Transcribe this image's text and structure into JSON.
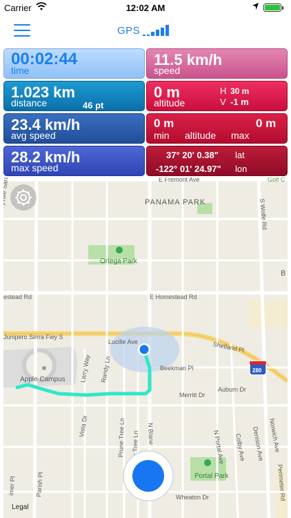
{
  "status_bar": {
    "carrier": "Carrier",
    "time": "12:02 AM"
  },
  "nav": {
    "title": "GPS",
    "menu_icon": "hamburger-icon",
    "signal_icon": "signal-bars-icon"
  },
  "stats": {
    "time": {
      "value": "00:02:44",
      "label": "time"
    },
    "speed": {
      "value": "11.5 km/h",
      "label": "speed"
    },
    "distance": {
      "value": "1.023 km",
      "label": "distance",
      "points": "46 pt"
    },
    "altitude": {
      "value": "0 m",
      "label": "altitude",
      "h_label": "H",
      "h_value": "30 m",
      "v_label": "V",
      "v_value": "-1 m"
    },
    "avg_speed": {
      "value": "23.4 km/h",
      "label": "avg speed"
    },
    "altitude_minmax": {
      "min_value": "0 m",
      "max_value": "0 m",
      "min_label": "min",
      "mid_label": "altitude",
      "max_label": "max"
    },
    "max_speed": {
      "value": "28.2 km/h",
      "label": "max speed"
    },
    "coords": {
      "lat_value": "37° 20' 0.38\"",
      "lat_label": "lat",
      "lon_value": "-122° 01' 24.97\"",
      "lon_label": "lon"
    }
  },
  "map": {
    "labels": {
      "fremont": "E Fremont Ave",
      "golf": "Golf C",
      "panama": "PANAMA PARK",
      "sunnyvale": "Sunnyvale Saratoga Rd",
      "wolfe": "S Wolfe Rd",
      "ortega": "Ortega Park",
      "homestead_w": "estead Rd",
      "homestead_e": "E Homestead Rd",
      "b": "B",
      "junipero": "Junipero Serra Fwy S",
      "lucille": "Lucille Ave",
      "shetland": "Shetland Pl",
      "apple": "Apple Campus",
      "larry": "Larry Way",
      "randy": "Randy Ln",
      "beekman": "Beekman Pl",
      "route": "280",
      "merritt": "Merritt Dr",
      "auburn": "Auburn Dr",
      "vista": "Vista Dr",
      "prune": "Prune Tree Ln",
      "plum": "Plum Tree Ln",
      "blaney": "N Blane",
      "portal_ave": "N Portal Ave",
      "colby": "Colby Ave",
      "denison": "Denison Ave",
      "norwich": "Norwich Ave",
      "portal_park": "Portal Park",
      "parish": "Parish Pl",
      "imer": "imer Pl",
      "wheaton": "Wheaton Dr",
      "perimeter": "Perimeter Rd"
    },
    "settings_icon": "gear-icon",
    "record_icon": "record-button-icon",
    "legal": "Legal"
  },
  "colors": {
    "accent": "#1b7ff0",
    "track": "#2ee8c8",
    "location": "#1976f2"
  }
}
